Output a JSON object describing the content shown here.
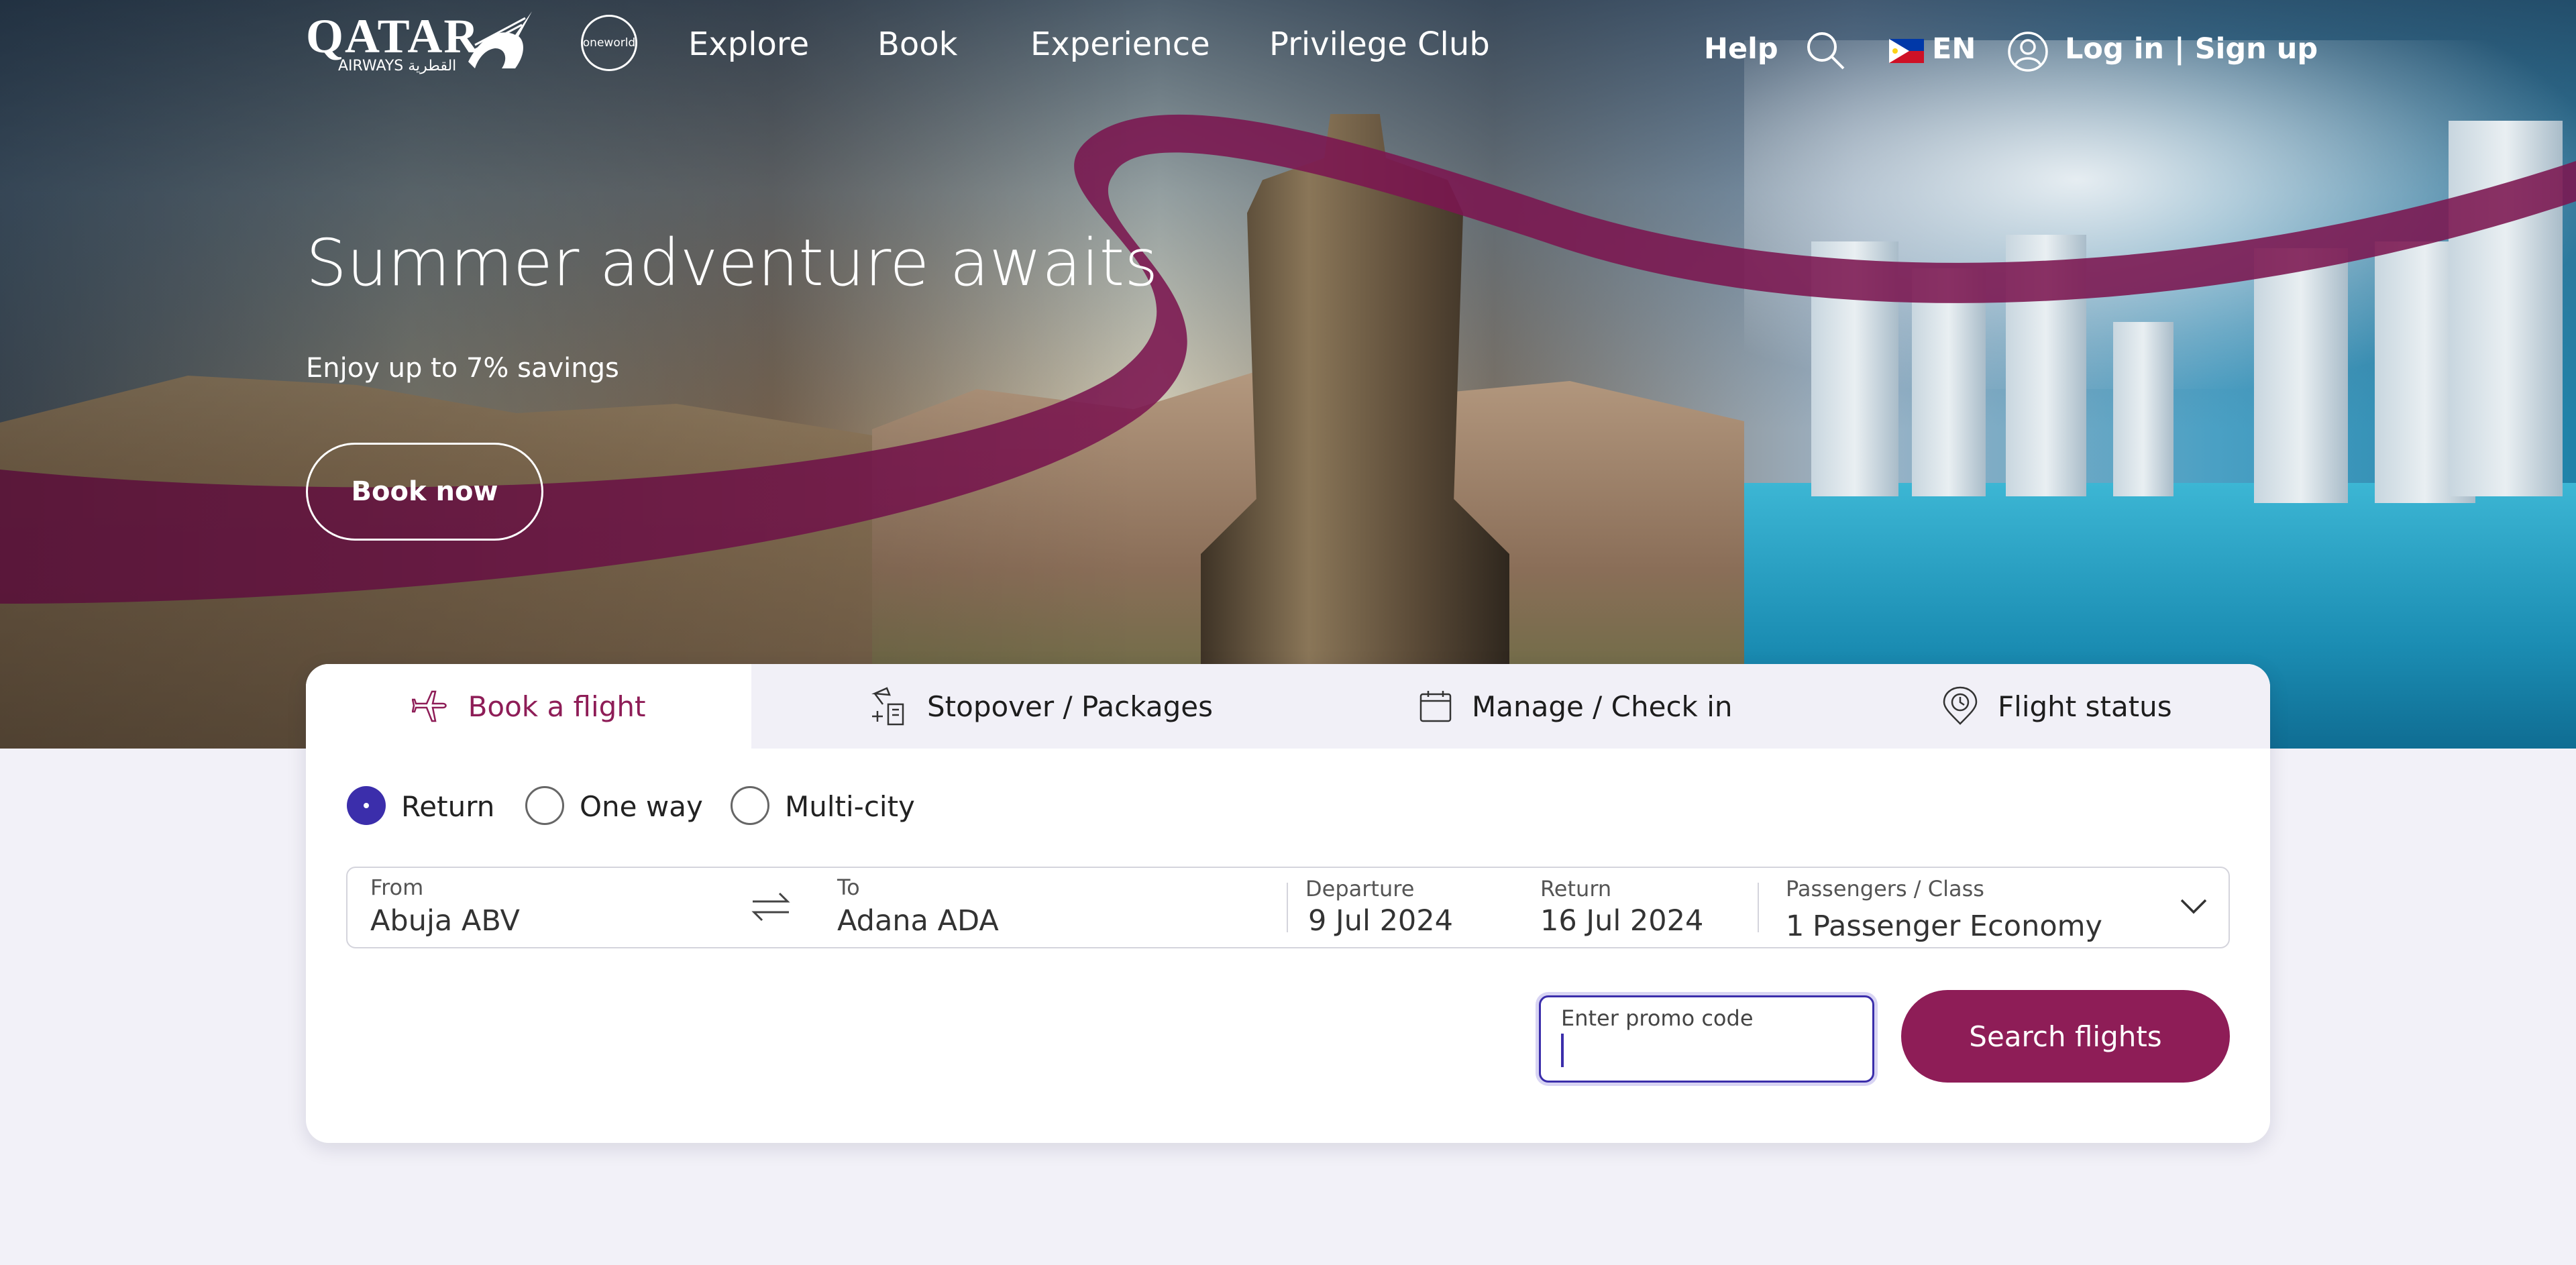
{
  "brand": {
    "logo_text": "QATAR",
    "logo_subtext": "AIRWAYS القطرية",
    "alliance": "oneworld",
    "accent_color": "#8e1d57",
    "focus_color": "#3b2eab"
  },
  "nav": {
    "items": [
      "Explore",
      "Book",
      "Experience",
      "Privilege Club"
    ],
    "help": "Help",
    "language": "EN",
    "login": "Log in | Sign up",
    "icons": [
      "search-icon",
      "flag-icon",
      "user-icon"
    ]
  },
  "hero": {
    "title": "Summer adventure awaits",
    "subtitle": "Enjoy up to 7% savings",
    "cta": "Book now"
  },
  "booking": {
    "tabs": [
      {
        "label": "Book a flight",
        "icon": "plane-icon",
        "active": true
      },
      {
        "label": "Stopover / Packages",
        "icon": "luggage-hotel-icon",
        "active": false
      },
      {
        "label": "Manage / Check in",
        "icon": "calendar-icon",
        "active": false
      },
      {
        "label": "Flight status",
        "icon": "location-clock-icon",
        "active": false
      }
    ],
    "trip_types": [
      {
        "label": "Return",
        "selected": true
      },
      {
        "label": "One way",
        "selected": false
      },
      {
        "label": "Multi-city",
        "selected": false
      }
    ],
    "from": {
      "label": "From",
      "value": "Abuja ABV"
    },
    "to": {
      "label": "To",
      "value": "Adana ADA"
    },
    "departure": {
      "label": "Departure",
      "value": "9 Jul 2024"
    },
    "return": {
      "label": "Return",
      "value": "16 Jul 2024"
    },
    "passengers": {
      "label": "Passengers / Class",
      "count": "1",
      "value": "Passenger Economy"
    },
    "promo": {
      "placeholder": "Enter promo code",
      "value": ""
    },
    "search_button": "Search flights"
  }
}
